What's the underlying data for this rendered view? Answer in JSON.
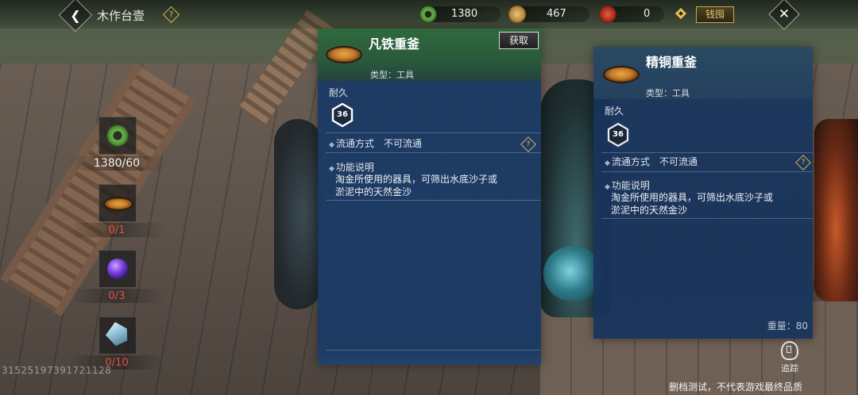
{
  "header": {
    "title": "木作台壹",
    "help_glyph": "?",
    "back_glyph": "❮",
    "close_glyph": "✕",
    "currencies": [
      {
        "name": "green-spiral-currency",
        "value": "1380",
        "color": "#5fa04a"
      },
      {
        "name": "copper-coin-currency",
        "value": "467",
        "color": "#c9a25a"
      },
      {
        "name": "red-gem-currency",
        "value": "0",
        "color": "#c2402e"
      }
    ],
    "recharge_label": "钱囤"
  },
  "materials": [
    {
      "icon": "green-spiral-icon",
      "count": "1380/60",
      "status": "enough"
    },
    {
      "icon": "gold-pan-icon",
      "count": "0/1",
      "status": "lacking"
    },
    {
      "icon": "purple-orb-icon",
      "count": "0/3",
      "status": "lacking"
    },
    {
      "icon": "crystal-ore-icon",
      "count": "0/10",
      "status": "lacking"
    }
  ],
  "uid": "31525197391721128",
  "card_primary": {
    "name": "凡铁重釜",
    "type": "类型：工具",
    "obtain_label": "获取",
    "durability_label": "耐久",
    "durability_value": "36",
    "circulation_label": "流通方式",
    "circulation_value": "不可流通",
    "function_label": "功能说明",
    "function_desc_1": "淘金所使用的器具，可筛出水底沙子或",
    "function_desc_2": "淤泥中的天然金沙",
    "help_glyph": "?"
  },
  "card_compare": {
    "name": "精铜重釜",
    "type": "类型：工具",
    "durability_label": "耐久",
    "durability_value": "36",
    "circulation_label": "流通方式",
    "circulation_value": "不可流通",
    "function_label": "功能说明",
    "function_desc_1": "淘金所使用的器具，可筛出水底沙子或",
    "function_desc_2": "淤泥中的天然金沙",
    "weight": "重量：80",
    "help_glyph": "?"
  },
  "trace_label": "追踪",
  "disclaimer": "删档测试，不代表游戏最终品质"
}
